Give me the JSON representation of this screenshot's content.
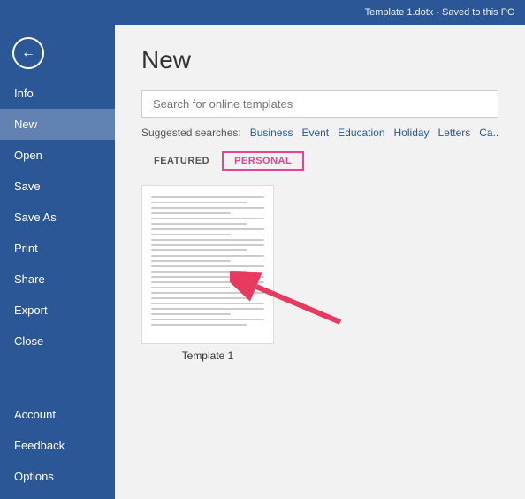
{
  "titlebar": {
    "text": "Template 1.dotx  -  Saved to this PC"
  },
  "sidebar": {
    "back_icon": "←",
    "items": [
      {
        "label": "Info",
        "id": "info",
        "active": false
      },
      {
        "label": "New",
        "id": "new",
        "active": true
      },
      {
        "label": "Open",
        "id": "open",
        "active": false
      },
      {
        "label": "Save",
        "id": "save",
        "active": false
      },
      {
        "label": "Save As",
        "id": "save-as",
        "active": false
      },
      {
        "label": "Print",
        "id": "print",
        "active": false
      },
      {
        "label": "Share",
        "id": "share",
        "active": false
      },
      {
        "label": "Export",
        "id": "export",
        "active": false
      },
      {
        "label": "Close",
        "id": "close",
        "active": false
      }
    ],
    "bottom_items": [
      {
        "label": "Account",
        "id": "account"
      },
      {
        "label": "Feedback",
        "id": "feedback"
      },
      {
        "label": "Options",
        "id": "options"
      }
    ]
  },
  "main": {
    "title": "New",
    "search": {
      "placeholder": "Search for online templates"
    },
    "suggested": {
      "label": "Suggested searches:",
      "links": [
        "Business",
        "Event",
        "Education",
        "Holiday",
        "Letters",
        "Ca..."
      ]
    },
    "tabs": [
      {
        "label": "FEATURED",
        "active": false
      },
      {
        "label": "PERSONAL",
        "active": true
      }
    ],
    "templates": [
      {
        "label": "Template 1",
        "id": "template-1"
      }
    ]
  }
}
